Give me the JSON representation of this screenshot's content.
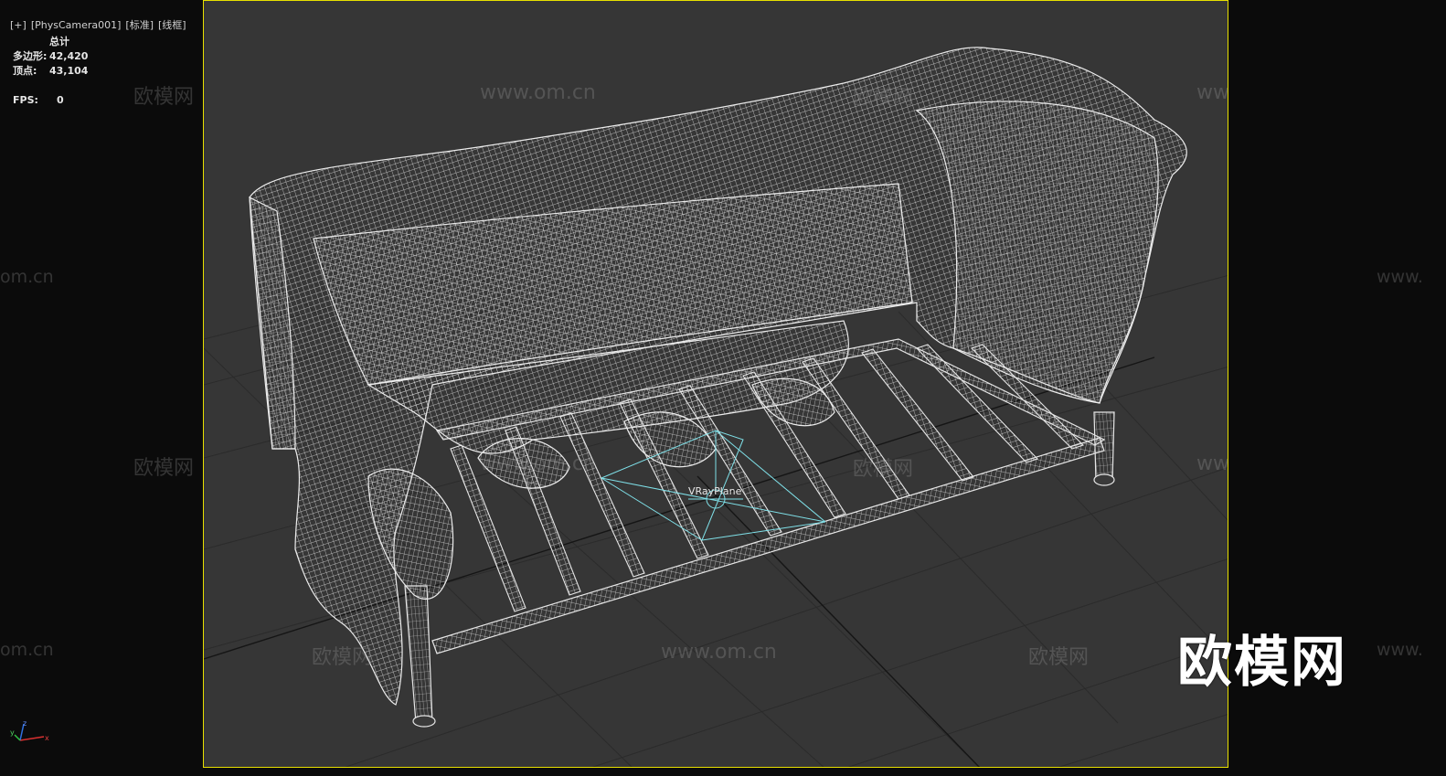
{
  "viewport_label": {
    "plus": "[+]",
    "camera": "[PhysCamera001]",
    "shading_standard": "[标准]",
    "shading_mode": "[线框]"
  },
  "stats": {
    "header": "总计",
    "polygons_label": "多边形:",
    "polygons_value": "42,420",
    "vertices_label": "顶点:",
    "vertices_value": "43,104",
    "fps_label": "FPS:",
    "fps_value": "0"
  },
  "scene": {
    "object_label": "VRayPlane",
    "viewport_border_color": "#e8e000",
    "wire_color": "#e6e6e6",
    "helper_color": "#7fe0e8",
    "grid_color": "#2a2a2a"
  },
  "watermarks": {
    "cn": "欧模网",
    "url": "www.om.cn",
    "url_left_edge": "om.cn",
    "url_right_edge": "www.",
    "logo": "欧模网"
  },
  "gizmo": {
    "z": "z",
    "y": "y",
    "x": "x"
  }
}
